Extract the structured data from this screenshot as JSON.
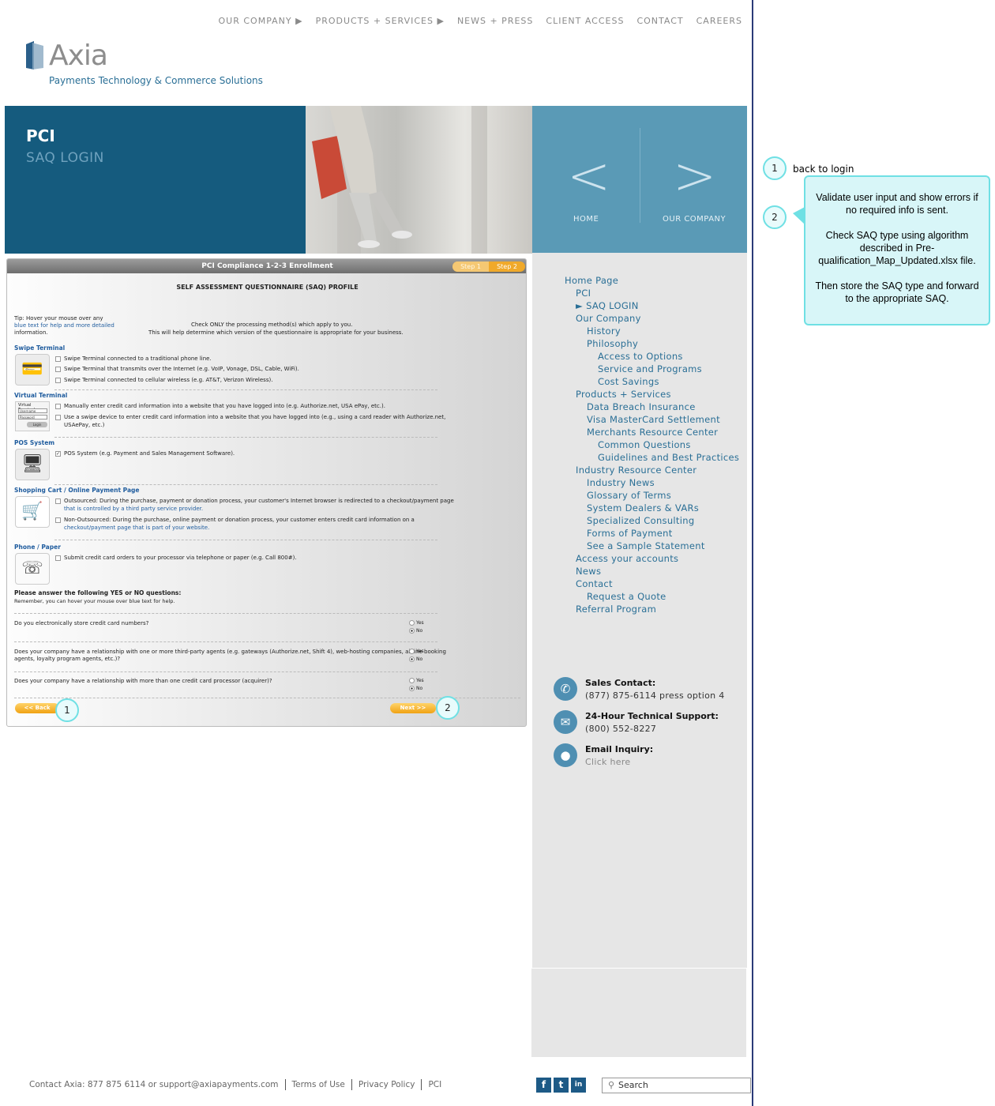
{
  "topnav": [
    {
      "label": "OUR COMPANY ▶"
    },
    {
      "label": "PRODUCTS + SERVICES ▶"
    },
    {
      "label": "NEWS + PRESS"
    },
    {
      "label": "CLIENT ACCESS"
    },
    {
      "label": "CONTACT"
    },
    {
      "label": "CAREERS"
    }
  ],
  "logo": {
    "name": "Axia",
    "tagline": "Payments Technology & Commerce Solutions"
  },
  "banner": {
    "title": "PCI",
    "subtitle": "SAQ LOGIN",
    "nav_home": "HOME",
    "nav_company": "OUR COMPANY",
    "prev_glyph": "<",
    "next_glyph": ">"
  },
  "sidenav": [
    {
      "label": "Home Page"
    },
    {
      "label": "PCI"
    },
    {
      "label": "► SAQ LOGIN"
    },
    {
      "label": "Our Company"
    },
    {
      "label": "History"
    },
    {
      "label": "Philosophy"
    },
    {
      "label": "Access to Options"
    },
    {
      "label": "Service and Programs"
    },
    {
      "label": "Cost Savings"
    },
    {
      "label": "Products + Services"
    },
    {
      "label": "Data Breach Insurance"
    },
    {
      "label": "Visa MasterCard Settlement"
    },
    {
      "label": "Merchants Resource Center"
    },
    {
      "label": "Common Questions"
    },
    {
      "label": "Guidelines and Best Practices"
    },
    {
      "label": "Industry Resource Center"
    },
    {
      "label": "Industry News"
    },
    {
      "label": "Glossary of Terms"
    },
    {
      "label": "System Dealers & VARs"
    },
    {
      "label": "Specialized Consulting"
    },
    {
      "label": "Forms of Payment"
    },
    {
      "label": "See a Sample Statement"
    },
    {
      "label": "Access your accounts"
    },
    {
      "label": "News"
    },
    {
      "label": "Contact"
    },
    {
      "label": "Request a Quote"
    },
    {
      "label": "Referral Program"
    }
  ],
  "contacts": [
    {
      "title": "Sales Contact:",
      "value": "(877) 875-6114 press option 4",
      "icon": "phone-icon"
    },
    {
      "title": "24-Hour Technical Support:",
      "value": "(800) 552-8227",
      "icon": "chat-icon"
    },
    {
      "title": "Email Inquiry:",
      "value": "Click here",
      "icon": "mail-icon"
    }
  ],
  "form": {
    "bar_title": "PCI Compliance 1-2-3 Enrollment",
    "step1": "Step 1",
    "step2": "Step 2",
    "heading": "SELF ASSESSMENT QUESTIONNAIRE (SAQ) PROFILE",
    "tip_1": "Tip: Hover your mouse over any",
    "tip_2": "blue text for help and more detailed",
    "tip_3": "information.",
    "intro_1": "Check ONLY the processing method(s) which apply to you.",
    "intro_2": "This will help determine which version of the questionnaire is appropriate for your business.",
    "sections": [
      {
        "title": "Swipe Terminal",
        "options": [
          "Swipe Terminal connected to a traditional phone line.",
          "Swipe Terminal that transmits over the Internet (e.g. VoIP, Vonage, DSL, Cable, WiFi).",
          "Swipe Terminal connected to cellular wireless (e.g. AT&T, Verizon Wireless)."
        ]
      },
      {
        "title": "Virtual Terminal",
        "options": [
          "Manually enter credit card information into a website that you have logged into (e.g. Authorize.net, USA ePay, etc.).",
          "Use a swipe device to enter credit card information into a website that you have logged into (e.g., using a card reader with Authorize.net,",
          "USAePay, etc.)"
        ]
      },
      {
        "title": "POS System",
        "options": [
          "POS System (e.g. Payment and Sales Management Software)."
        ]
      },
      {
        "title": "Shopping Cart / Online Payment Page",
        "options": [
          "Outsourced: During the purchase, payment or donation process, your customer's Internet browser is redirected to a checkout/payment page",
          "that is controlled by a third party service provider.",
          "Non-Outsourced: During the purchase, online payment or donation process, your customer enters credit card information on a",
          "checkout/payment page that is part of your website."
        ]
      },
      {
        "title": "Phone / Paper",
        "options": [
          "Submit credit card orders to your processor via telephone or paper (e.g. Call 800#)."
        ]
      }
    ],
    "vt_labels": [
      "Virtual Terminal",
      "Username",
      "Password",
      "Login"
    ],
    "questions_title": "Please answer the following YES or NO questions:",
    "questions_sub": "Remember, you can hover your mouse over blue text for help.",
    "questions": [
      {
        "text": "Do you electronically store credit card numbers?",
        "text2": ""
      },
      {
        "text": "Does your company have a relationship with one or more third-party agents (e.g. gateways (Authorize.net, Shift 4), web-hosting companies, airline booking",
        "text2": "agents, loyalty program agents, etc.)?"
      },
      {
        "text": "Does your company have a relationship with more than one credit card processor (acquirer)?",
        "text2": ""
      }
    ],
    "yes": "Yes",
    "no": "No",
    "back": "<< Back",
    "next": "Next >>"
  },
  "annotations": {
    "one": "1",
    "two": "2",
    "label1": "back to login",
    "callout_p1": "Validate user input and show errors if no required info is sent.",
    "callout_p2": "Check SAQ type using algorithm described in Pre-qualification_Map_Updated.xlsx file.",
    "callout_p3": "Then store the SAQ type and forward to the appropriate SAQ."
  },
  "footer": {
    "contact": "Contact Axia: 877 875 6114 or support@axiapayments.com",
    "terms": "Terms of Use",
    "privacy": "Privacy Policy",
    "pci": "PCI",
    "search_placeholder": "Search",
    "social": [
      "f",
      "t",
      "in"
    ]
  },
  "colors": {
    "banner_dark": "#155b7e",
    "banner_light": "#5a9ab6",
    "link": "#2a6f96",
    "accent_orange": "#f0a213",
    "callout": "#d8f6f8"
  }
}
